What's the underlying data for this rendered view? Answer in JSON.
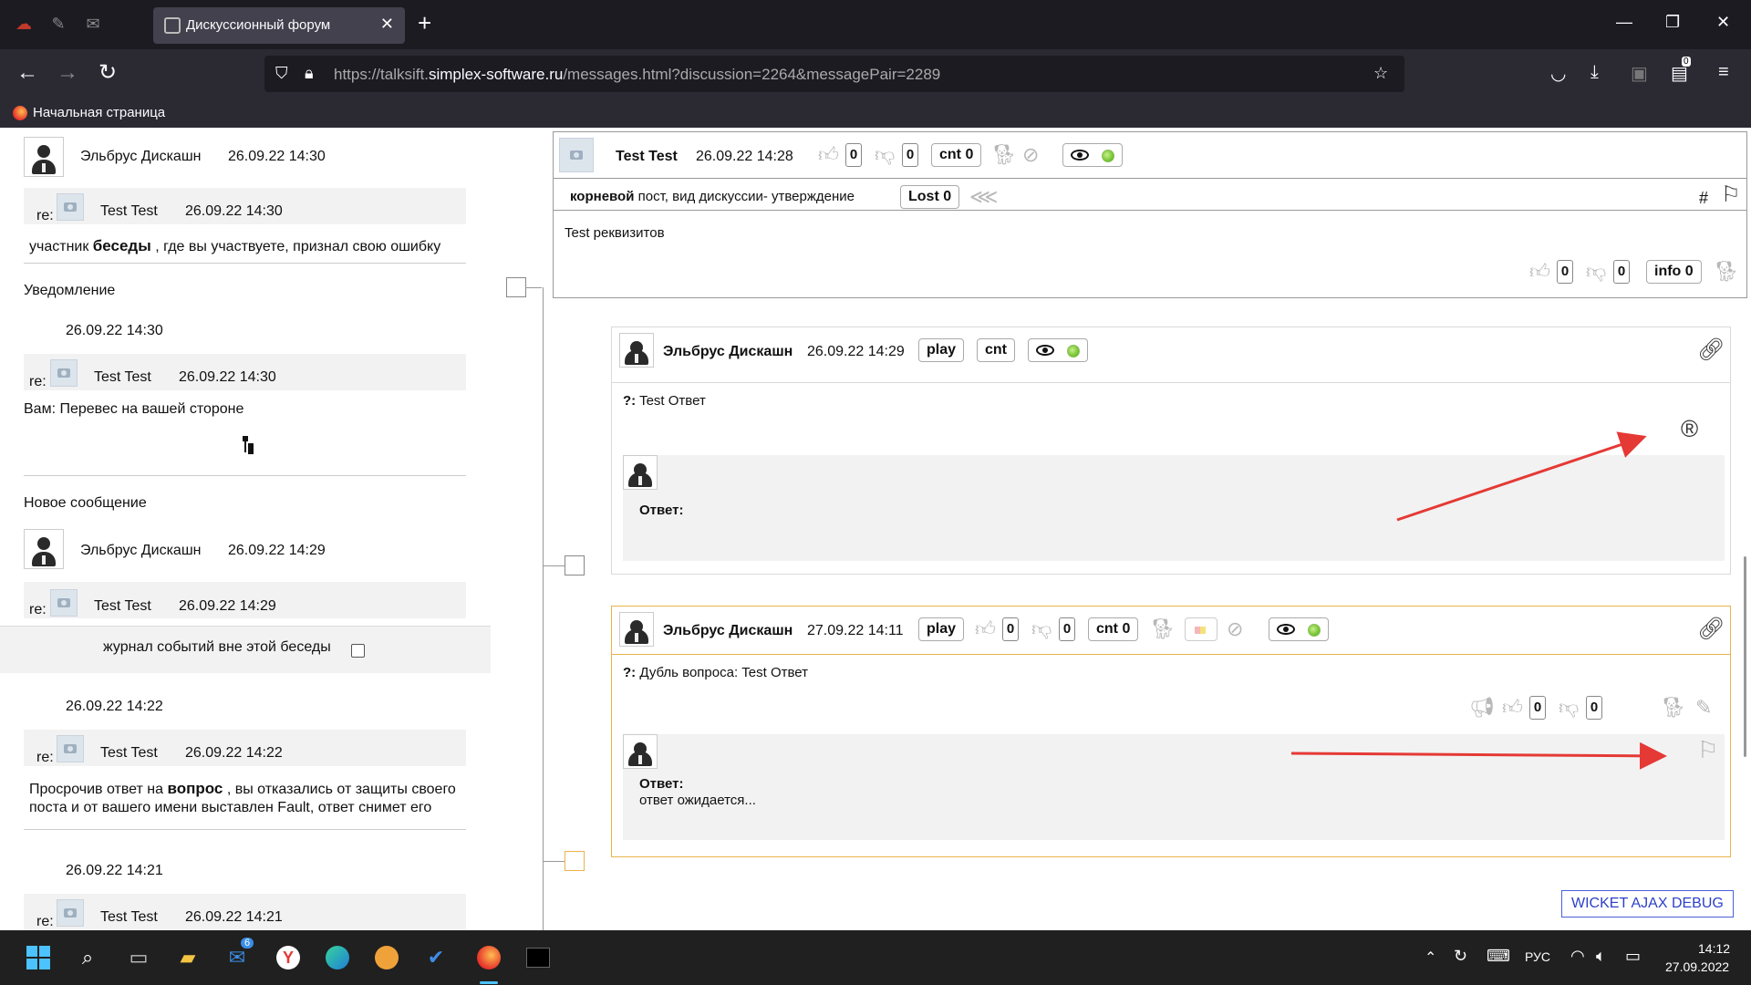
{
  "browser": {
    "tab_title": "Дискуссионный форум",
    "url_prefix": "https://talksift.",
    "url_domain": "simplex-software.ru",
    "url_path": "/messages.html?discussion=2264&messagePair=2289",
    "bookmark": "Начальная страница",
    "downloads_badge": "0"
  },
  "sidebar": {
    "entry1": {
      "author": "Эльбрус Дискашн",
      "time": "26.09.22 14:30",
      "re": "re:",
      "re_author": "Test Test",
      "re_time": "26.09.22 14:30",
      "text_a": "участник",
      "text_bold": "беседы",
      "text_b": ", где вы участвуете, признал свою ошибку"
    },
    "notice_title": "Уведомление",
    "entry2": {
      "time": "26.09.22 14:30",
      "re": "re:",
      "re_author": "Test Test",
      "re_time": "26.09.22 14:30",
      "text": "Вам: Перевес на вашей стороне"
    },
    "new_msg_title": "Новое сообщение",
    "entry3": {
      "author": "Эльбрус Дискашн",
      "time": "26.09.22 14:29",
      "re": "re:",
      "re_author": "Test Test",
      "re_time": "26.09.22 14:29"
    },
    "journal_label": "журнал событий вне этой беседы",
    "entry4": {
      "time": "26.09.22 14:22",
      "re": "re:",
      "re_author": "Test Test",
      "re_time": "26.09.22 14:22",
      "text_a": "Просрочив ответ на",
      "text_bold": "вопрос",
      "text_b": ", вы отказались от защиты своего",
      "text_c": "поста и от вашего имени выставлен Fault, ответ снимет его"
    },
    "entry5": {
      "time": "26.09.22 14:21",
      "re": "re:",
      "re_author": "Test Test",
      "re_time": "26.09.22 14:21"
    }
  },
  "root_post": {
    "author": "Test Test",
    "time": "26.09.22 14:28",
    "likes": "0",
    "dislikes": "0",
    "cnt": "cnt 0",
    "type_bold": "корневой",
    "type_rest": "пост, вид дискуссии- утверждение",
    "lost": "Lost 0",
    "hash": "#",
    "body": "Test реквизитов",
    "likes2": "0",
    "dislikes2": "0",
    "info": "info 0"
  },
  "reply1": {
    "author": "Эльбрус Дискашн",
    "time": "26.09.22 14:29",
    "play": "play",
    "cnt": "cnt",
    "q_mark": "?:",
    "question": "Test Ответ",
    "answer_label": "Ответ:"
  },
  "reply2": {
    "author": "Эльбрус Дискашн",
    "time": "27.09.22 14:11",
    "play": "play",
    "likes": "0",
    "dislikes": "0",
    "cnt": "cnt 0",
    "q_mark": "?:",
    "question": "Дубль вопроса: Test Ответ",
    "likes2": "0",
    "dislikes2": "0",
    "answer_label": "Ответ:",
    "answer_text": "ответ ожидается..."
  },
  "debug_label": "WICKET AJAX DEBUG",
  "taskbar": {
    "lang": "РУС",
    "time": "14:12",
    "date": "27.09.2022",
    "mail_badge": "6"
  },
  "colors": {
    "arrow": "#e53935",
    "selected_border": "#e8b34b",
    "debug_link": "#2d40c9"
  }
}
